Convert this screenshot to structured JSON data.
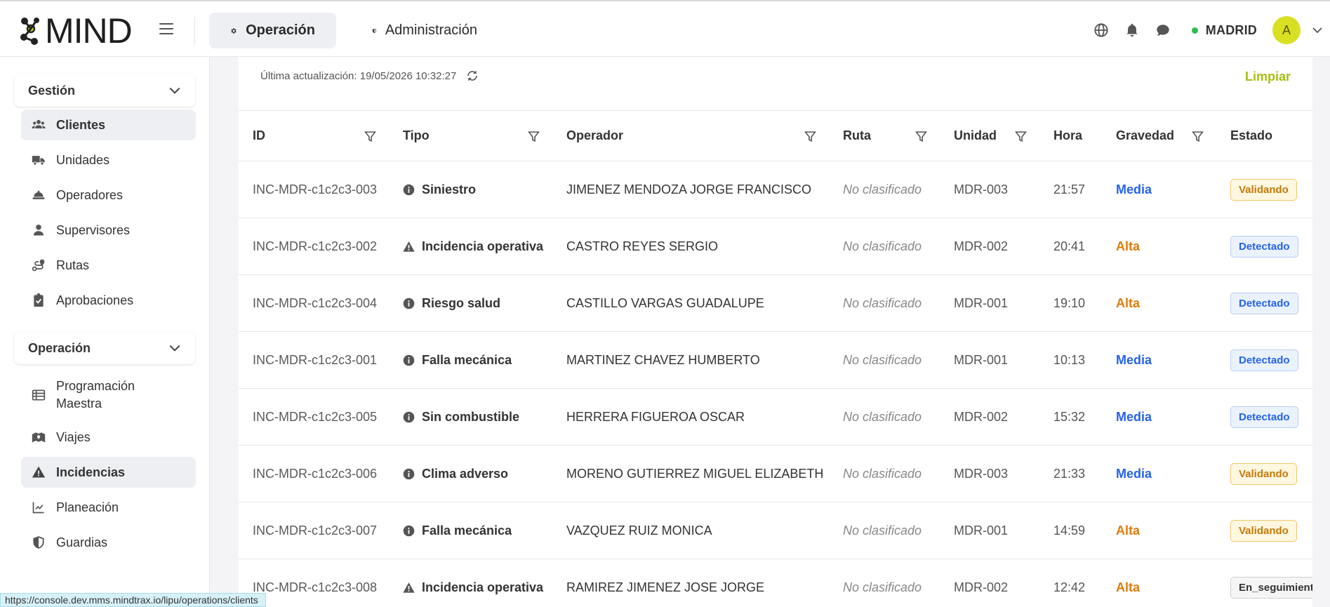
{
  "app": {
    "logo_text": "MIND"
  },
  "header": {
    "tabs": [
      {
        "label": "Operación",
        "icon": "gear-icon",
        "active": true
      },
      {
        "label": "Administración",
        "icon": "shield-icon",
        "active": false
      }
    ],
    "city": "MADRID",
    "avatar_initial": "A",
    "status_color": "#2ebd4f"
  },
  "sidebar": {
    "sections": [
      {
        "title": "Gestión",
        "items": [
          {
            "label": "Clientes",
            "icon": "users-icon",
            "active": true
          },
          {
            "label": "Unidades",
            "icon": "truck-icon",
            "active": false
          },
          {
            "label": "Operadores",
            "icon": "operator-hat-icon",
            "active": false
          },
          {
            "label": "Supervisores",
            "icon": "user-icon",
            "active": false
          },
          {
            "label": "Rutas",
            "icon": "route-icon",
            "active": false
          },
          {
            "label": "Aprobaciones",
            "icon": "clipboard-check-icon",
            "active": false
          }
        ]
      },
      {
        "title": "Operación",
        "items": [
          {
            "label": "Programación Maestra",
            "icon": "table-list-icon",
            "active": false
          },
          {
            "label": "Viajes",
            "icon": "map-icon",
            "active": false
          },
          {
            "label": "Incidencias",
            "icon": "warning-icon",
            "active": true
          },
          {
            "label": "Planeación",
            "icon": "chart-line-icon",
            "active": false
          },
          {
            "label": "Guardias",
            "icon": "shield-icon",
            "active": false
          }
        ]
      }
    ]
  },
  "main": {
    "last_update": "Última actualización: 19/05/2026 10:32:27",
    "clear_label": "Limpiar",
    "columns": [
      "ID",
      "Tipo",
      "Operador",
      "Ruta",
      "Unidad",
      "Hora",
      "Gravedad",
      "Estado"
    ],
    "rows": [
      {
        "id": "INC-MDR-c1c2c3-003",
        "tipo": "Siniestro",
        "tipo_icon": "info-icon",
        "operador": "JIMENEZ MENDOZA JORGE FRANCISCO",
        "ruta": "No clasificado",
        "unidad": "MDR-003",
        "hora": "21:57",
        "gravedad": "Media",
        "estado": "Validando"
      },
      {
        "id": "INC-MDR-c1c2c3-002",
        "tipo": "Incidencia operativa",
        "tipo_icon": "warning-icon",
        "operador": "CASTRO REYES SERGIO",
        "ruta": "No clasificado",
        "unidad": "MDR-002",
        "hora": "20:41",
        "gravedad": "Alta",
        "estado": "Detectado"
      },
      {
        "id": "INC-MDR-c1c2c3-004",
        "tipo": "Riesgo salud",
        "tipo_icon": "info-icon",
        "operador": "CASTILLO VARGAS GUADALUPE",
        "ruta": "No clasificado",
        "unidad": "MDR-001",
        "hora": "19:10",
        "gravedad": "Alta",
        "estado": "Detectado"
      },
      {
        "id": "INC-MDR-c1c2c3-001",
        "tipo": "Falla mecánica",
        "tipo_icon": "info-icon",
        "operador": "MARTINEZ CHAVEZ HUMBERTO",
        "ruta": "No clasificado",
        "unidad": "MDR-001",
        "hora": "10:13",
        "gravedad": "Media",
        "estado": "Detectado"
      },
      {
        "id": "INC-MDR-c1c2c3-005",
        "tipo": "Sin combustible",
        "tipo_icon": "info-icon",
        "operador": "HERRERA FIGUEROA OSCAR",
        "ruta": "No clasificado",
        "unidad": "MDR-002",
        "hora": "15:32",
        "gravedad": "Media",
        "estado": "Detectado"
      },
      {
        "id": "INC-MDR-c1c2c3-006",
        "tipo": "Clima adverso",
        "tipo_icon": "info-icon",
        "operador": "MORENO GUTIERREZ MIGUEL ELIZABETH",
        "ruta": "No clasificado",
        "unidad": "MDR-003",
        "hora": "21:33",
        "gravedad": "Media",
        "estado": "Validando"
      },
      {
        "id": "INC-MDR-c1c2c3-007",
        "tipo": "Falla mecánica",
        "tipo_icon": "info-icon",
        "operador": "VAZQUEZ RUIZ MONICA",
        "ruta": "No clasificado",
        "unidad": "MDR-001",
        "hora": "14:59",
        "gravedad": "Alta",
        "estado": "Validando"
      },
      {
        "id": "INC-MDR-c1c2c3-008",
        "tipo": "Incidencia operativa",
        "tipo_icon": "warning-icon",
        "operador": "RAMIREZ JIMENEZ JOSE JORGE",
        "ruta": "No clasificado",
        "unidad": "MDR-002",
        "hora": "12:42",
        "gravedad": "Alta",
        "estado": "En_seguimiento"
      }
    ],
    "colors": {
      "media": "#2563eb",
      "alta": "#e07b0b",
      "accent": "#a7bf12"
    }
  },
  "status_url": "https://console.dev.mms.mindtrax.io/lipu/operations/clients"
}
